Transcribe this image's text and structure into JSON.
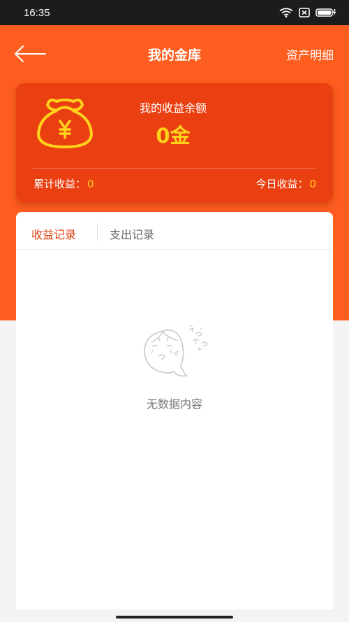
{
  "status_bar": {
    "time": "16:35"
  },
  "header": {
    "title": "我的金库",
    "right_action": "资产明细"
  },
  "balance_card": {
    "label": "我的收益余额",
    "value": "0金",
    "accumulated_label": "累计收益：",
    "accumulated_value": "0",
    "today_label": "今日收益：",
    "today_value": "0"
  },
  "tabs": [
    {
      "label": "收益记录",
      "active": true
    },
    {
      "label": "支出记录",
      "active": false
    }
  ],
  "empty_state": {
    "text": "无数据内容"
  },
  "colors": {
    "brand_orange": "#fd5e20",
    "card_red": "#e93f11",
    "gold": "#ffd21c",
    "tab_active": "#e23d0d"
  }
}
